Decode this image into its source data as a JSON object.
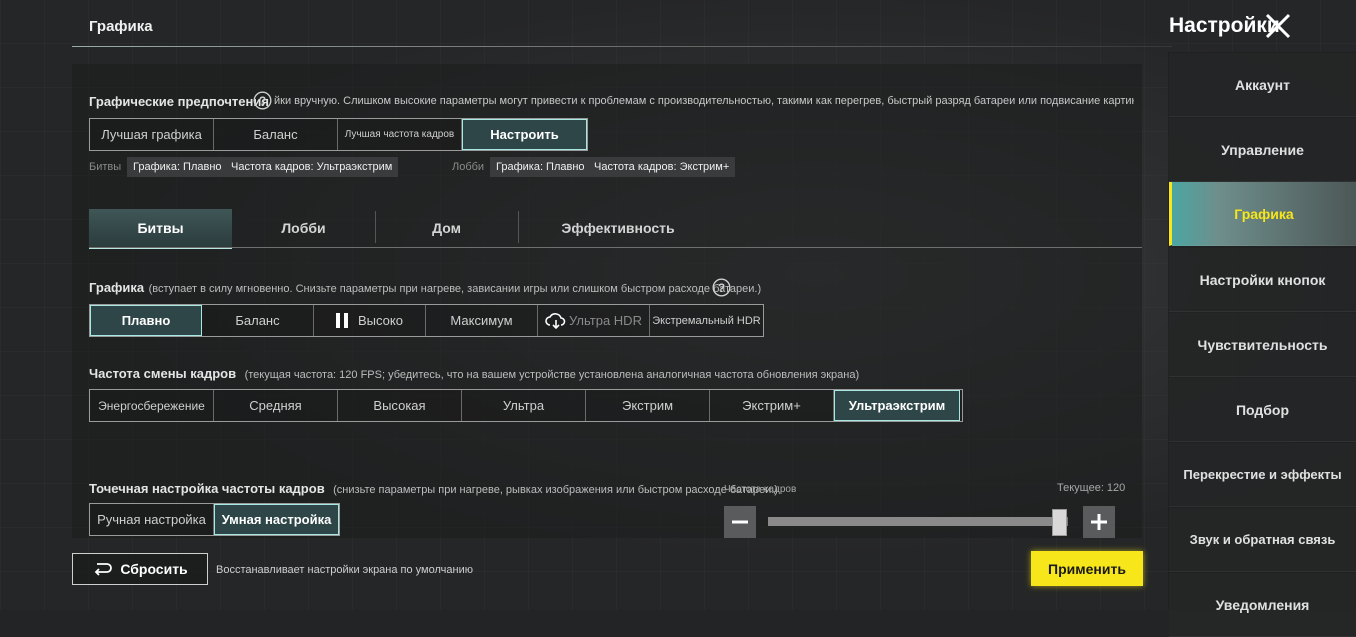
{
  "header": {
    "title": "Графика",
    "settings_title": "Настройки"
  },
  "preferences": {
    "label": "Графические предпочтения",
    "hint": "йки вручную. Слишком высокие параметры могут привести к проблемам с производительностью, такими как перегрев, быстрый разряд батареи или подвисание картинки",
    "options": [
      "Лучшая графика",
      "Баланс",
      "Лучшая частота кадров",
      "Настроить"
    ],
    "selected": 3
  },
  "summary": {
    "battles_label": "Битвы",
    "battles_graphics": "Графика: Плавно",
    "battles_fps": "Частота кадров: Ультраэкстрим",
    "lobby_label": "Лобби",
    "lobby_graphics": "Графика: Плавно",
    "lobby_fps": "Частота кадров: Экстрим+"
  },
  "tabs": [
    "Битвы",
    "Лобби",
    "Дом",
    "Эффективность"
  ],
  "graphics": {
    "label": "Графика",
    "hint": "(вступает в силу мгновенно. Снизьте параметры при нагреве, зависании игры или слишком быстром расходе батареи.)",
    "options": [
      "Плавно",
      "Баланс",
      "Высоко",
      "Максимум",
      "Ультра HDR",
      "Экстремальный HDR"
    ],
    "selected": 0
  },
  "fps": {
    "label": "Частота смены кадров",
    "hint": "(текущая частота: 120 FPS; убедитесь, что на вашем устройстве установлена аналогичная частота обновления экрана)",
    "options": [
      "Энергосбережение",
      "Средняя",
      "Высокая",
      "Ультра",
      "Экстрим",
      "Экстрим+",
      "Ультраэкстрим"
    ],
    "selected": 6
  },
  "fine_fps": {
    "label": "Точечная настройка частоты кадров",
    "hint": "(снизьте параметры при нагреве, рывках изображения или быстром расходе батареи.)",
    "options": [
      "Ручная настройка",
      "Умная настройка"
    ],
    "selected": 1,
    "slider_label": "Частота кадров",
    "current_label": "Текущее: 120",
    "slider_fraction": 0.99
  },
  "footer": {
    "reset_label": "Сбросить",
    "reset_hint": "Восстанавливает настройки экрана по умолчанию",
    "apply_label": "Применить"
  },
  "sidebar": {
    "items": [
      "Аккаунт",
      "Управление",
      "Графика",
      "Настройки кнопок",
      "Чувствительность",
      "Подбор",
      "Перекрестие и эффекты",
      "Звук и обратная связь",
      "Уведомления"
    ],
    "selected": 2
  },
  "colors": {
    "accent_teal": "#a8e8e2",
    "apply_yellow": "#f7e619"
  }
}
